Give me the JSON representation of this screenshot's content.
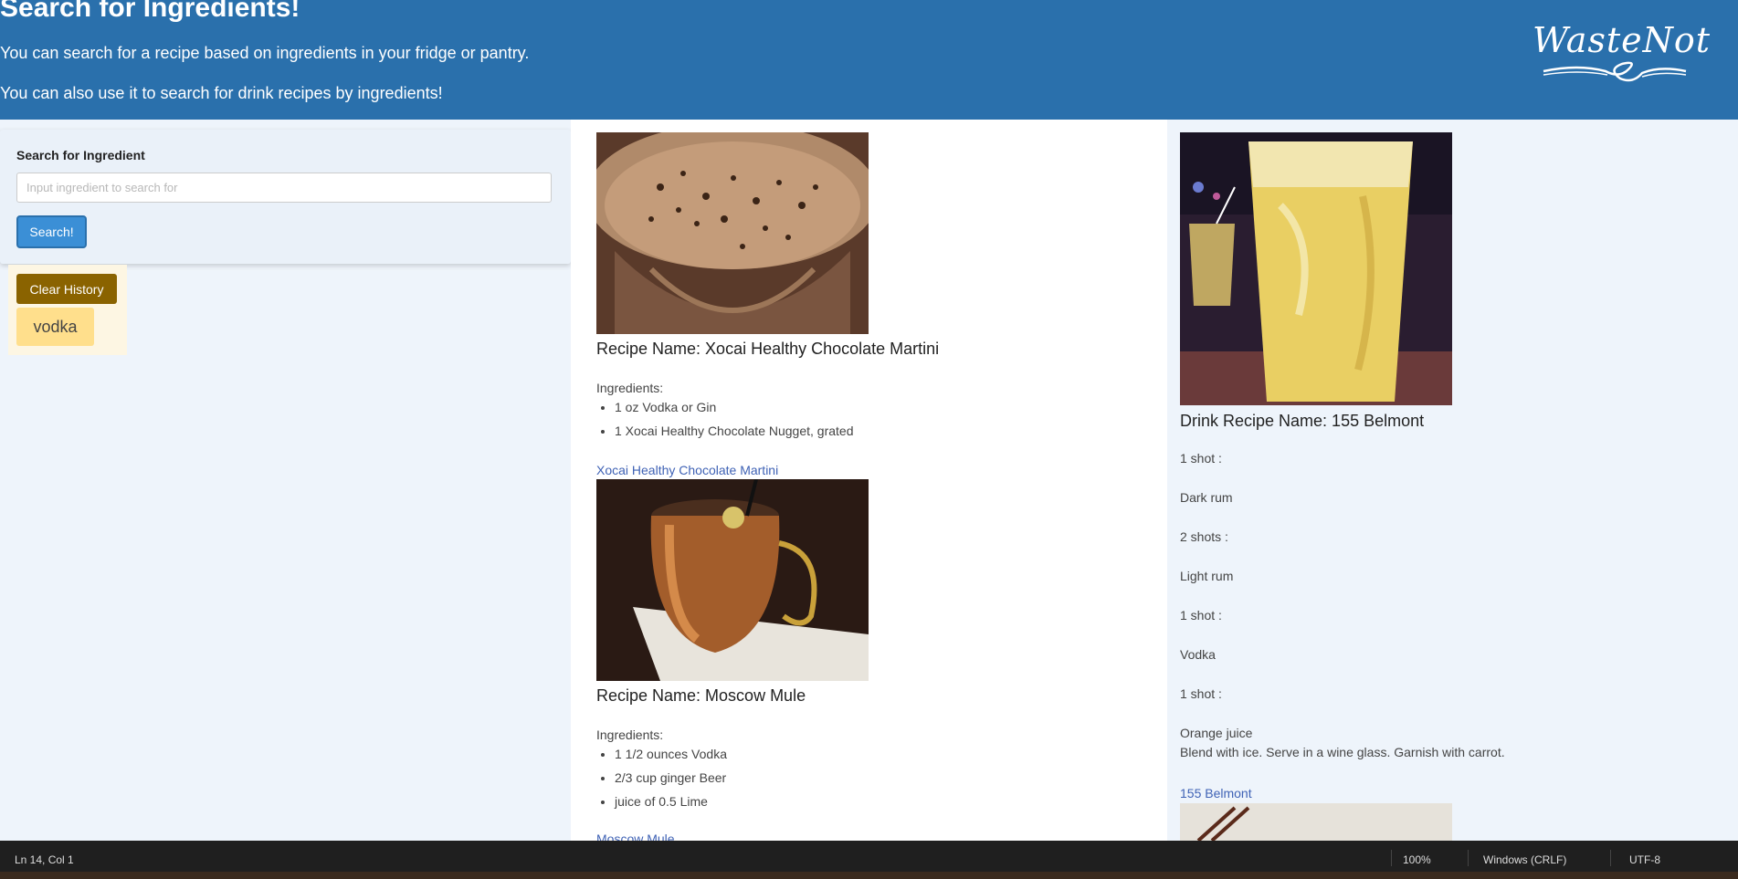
{
  "header": {
    "title": "Search for Ingredients!",
    "line1": "You can search for a recipe based on ingredients in your fridge or pantry.",
    "line2": "You can also use it to search for drink recipes by ingredients!",
    "logo_text": "WasteNot"
  },
  "search": {
    "label": "Search for Ingredient",
    "placeholder": "Input ingredient to search for",
    "value": "",
    "button": "Search!"
  },
  "history": {
    "clear_button": "Clear History",
    "items": [
      "vodka"
    ]
  },
  "recipes": [
    {
      "name": "Recipe Name: Xocai Healthy Chocolate Martini",
      "ingredients_label": "Ingredients:",
      "ingredients": [
        "1 oz Vodka or Gin",
        "1 Xocai Healthy Chocolate Nugget, grated"
      ],
      "link": "Xocai Healthy Chocolate Martini"
    },
    {
      "name": "Recipe Name: Moscow Mule",
      "ingredients_label": "Ingredients:",
      "ingredients": [
        "1 1/2 ounces Vodka",
        "2/3 cup ginger Beer",
        "juice of 0.5 Lime"
      ],
      "link": "Moscow Mule"
    }
  ],
  "drink": {
    "name": "Drink Recipe Name: 155 Belmont",
    "lines": [
      "1 shot :",
      "Dark rum",
      "2 shots :",
      "Light rum",
      "1 shot :",
      "Vodka",
      "1 shot :",
      "Orange juice"
    ],
    "instructions": "Blend with ice. Serve in a wine glass. Garnish with carrot.",
    "link": "155 Belmont"
  },
  "statusbar": {
    "position": "Ln 14, Col 1",
    "zoom": "100%",
    "line_ending": "Windows (CRLF)",
    "encoding": "UTF-8"
  },
  "colors": {
    "header_bg": "#2a70ac",
    "search_button": "#3b8fd6",
    "clear_button": "#8a6300",
    "history_chip": "#ffdf8c",
    "link": "#3f62b5"
  }
}
